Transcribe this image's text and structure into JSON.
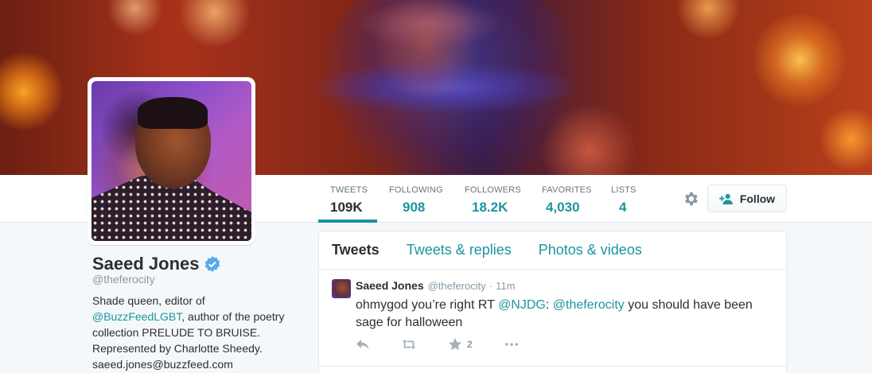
{
  "profile": {
    "name": "Saeed Jones",
    "handle": "@theferocity",
    "bio": {
      "line1": "Shade queen, editor of",
      "mention": "@BuzzFeedLGBT",
      "line2": ", author of the poetry collection PRELUDE TO BRUISE. Represented by Charlotte Sheedy.",
      "email": "saeed.jones@buzzfeed.com"
    }
  },
  "stats": [
    {
      "label": "TWEETS",
      "value": "109K"
    },
    {
      "label": "FOLLOWING",
      "value": "908"
    },
    {
      "label": "FOLLOWERS",
      "value": "18.2K"
    },
    {
      "label": "FAVORITES",
      "value": "4,030"
    },
    {
      "label": "LISTS",
      "value": "4"
    }
  ],
  "actions": {
    "follow_label": "Follow",
    "settings_icon": "gear-icon",
    "follow_icon": "add-user-icon"
  },
  "tabs": [
    {
      "label": "Tweets",
      "active": true
    },
    {
      "label": "Tweets & replies",
      "active": false
    },
    {
      "label": "Photos & videos",
      "active": false
    }
  ],
  "tweet": {
    "name": "Saeed Jones",
    "handle": "@theferocity",
    "dot": "·",
    "time": "11m",
    "text_prefix": "ohmygod you’re right RT ",
    "mention1": "@NJDG",
    "text_mid": ": ",
    "mention2": "@theferocity",
    "text_suffix": " you should have been sage for halloween",
    "favorite_count": "2"
  },
  "colors": {
    "accent": "#1b95a1",
    "text": "#292f33",
    "muted": "#8899a6",
    "verified": "#55acee"
  }
}
